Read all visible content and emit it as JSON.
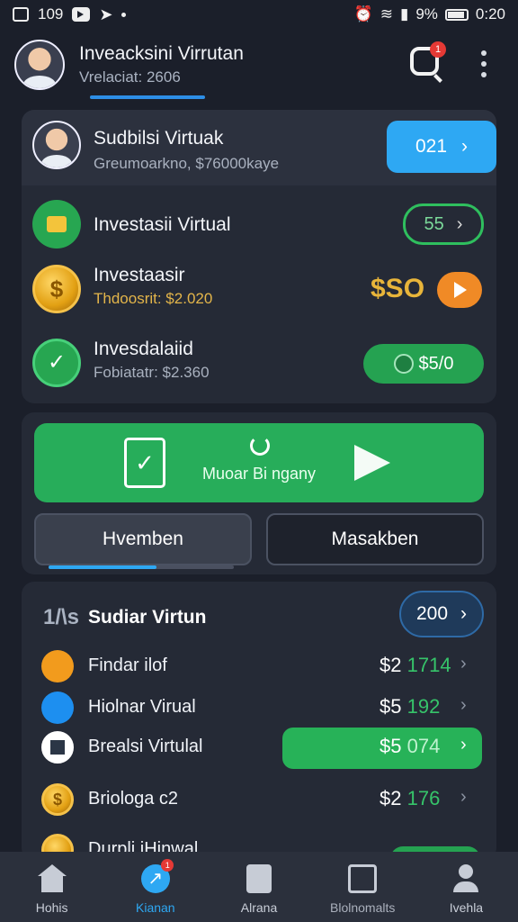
{
  "status": {
    "time_left": "109",
    "time_right": "0:20",
    "battery": "9%"
  },
  "header": {
    "title": "Inveacksini Virrutan",
    "subtitle": "Vrelaciat: 2606",
    "badge": "1"
  },
  "card1": {
    "profile": {
      "title": "Sudbilsi Virtuak",
      "subtitle": "Greumoarkno, $76000kaye",
      "button": "021"
    },
    "rows": [
      {
        "title": "Investasii Virtual",
        "value": "55"
      },
      {
        "title": "Investaasir",
        "subtitle": "Thdoosrit: $2.020",
        "value": "$SO"
      },
      {
        "title": "Invesdalaiid",
        "subtitle": "Fobiatatr: $2.360",
        "value": "$5/0"
      }
    ]
  },
  "card2": {
    "action": "Muoar Bi ngany",
    "tabs": [
      "Hvemben",
      "Masakben"
    ]
  },
  "list": {
    "title": "Sudiar Virtun",
    "logo": "1/\\s",
    "count": "200",
    "items": [
      {
        "label": "Findar ilof",
        "amount_white": "$2",
        "amount_green": "1714"
      },
      {
        "label": "Hiolnar Virual",
        "amount_white": "$5",
        "amount_green": "192"
      },
      {
        "label": "Brealsi Virtulal",
        "amount_white": "$5",
        "amount_green": "074"
      },
      {
        "label": "Briologa c2",
        "amount_white": "$2",
        "amount_green": "176"
      },
      {
        "label": "Durpli iHinwal",
        "amount_white": "",
        "amount_green": ""
      }
    ]
  },
  "nav": [
    {
      "label": "Hohis",
      "icon": "home-icon"
    },
    {
      "label": "Kianan",
      "icon": "chart-icon",
      "badge": "1"
    },
    {
      "label": "Alrana",
      "icon": "document-icon"
    },
    {
      "label": "Blolnomalts",
      "icon": "inbox-icon"
    },
    {
      "label": "Ivehla",
      "icon": "profile-icon"
    }
  ],
  "colors": {
    "accent_blue": "#2ea8f3",
    "green": "#27ad5a",
    "background": "#1b1f2a",
    "card": "#252a36"
  }
}
